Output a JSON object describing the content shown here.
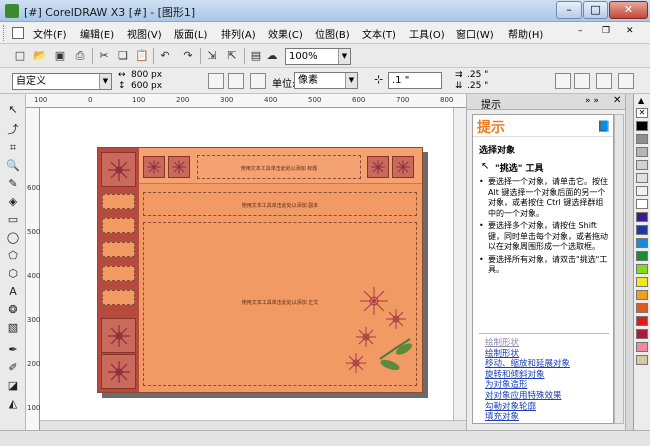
{
  "window": {
    "title": "[#] CorelDRAW X3 [#] - [图形1]",
    "min": "–",
    "max": "□",
    "close": "✕"
  },
  "menu": [
    "文件(F)",
    "编辑(E)",
    "视图(V)",
    "版面(L)",
    "排列(A)",
    "效果(C)",
    "位图(B)",
    "文本(T)",
    "工具(O)",
    "窗口(W)",
    "帮助(H)"
  ],
  "toolbar": {
    "zoom": "100%"
  },
  "propbar": {
    "paper_preset": "自定义",
    "width": "800 px",
    "height": "600 px",
    "units_label": "单位:",
    "units": "像素",
    "nudge": ".1 \"",
    "dup_x": ".25 \"",
    "dup_y": ".25 \""
  },
  "rulers": {
    "h": [
      "100",
      "0",
      "100",
      "200",
      "300",
      "400",
      "500",
      "600",
      "700",
      "800",
      "900"
    ],
    "v": [
      "600",
      "500",
      "400",
      "300",
      "200",
      "100"
    ]
  },
  "design": {
    "title_text": "使用文本工具单击此处以添加 标题",
    "sub_text": "使用文本工具单击此处以添加 副本",
    "body_text": "使用文本工具单击此处以添加 正文"
  },
  "docker": {
    "tab_title": "提示",
    "header": "提示",
    "section": "选择对象",
    "tool_name": "\"挑选\" 工具",
    "bullets": [
      "要选择一个对象，请单击它。按住 Alt 键选择一个对象后面的另一个对象，或者按住 Ctrl 键选择群组中的一个对象。",
      "要选择多个对象，请按住 Shift 键，同时单击每个对象，或者拖动以在对象周围形成一个选取框。",
      "要选择所有对象，请双击\"挑选\"工具。"
    ],
    "links": [
      "绘制形状",
      "绘制形状",
      "移动、缩放和延展对象",
      "旋转和倾斜对象",
      "为对象造形",
      "对对象应用特殊效果",
      "勾勒对象轮廓",
      "填充对象"
    ]
  },
  "palette": [
    "#ffffff",
    "#000000",
    "#8e8e8e",
    "#b5b5b5",
    "#d0d0d0",
    "#e0e0e0",
    "#f0f0f0",
    "#ffffff",
    "#3a1d8a",
    "#1d3a9a",
    "#1d88d8",
    "#1d8a3a",
    "#8ad81d",
    "#f0e81d",
    "#f0a01d",
    "#e05a1d",
    "#d81d1d",
    "#a81d3a",
    "#f08aa0",
    "#d8c8a0"
  ],
  "colors": {
    "accent": "#f27a1c",
    "design_bg": "#f29a63",
    "design_dark": "#b64a3e"
  }
}
